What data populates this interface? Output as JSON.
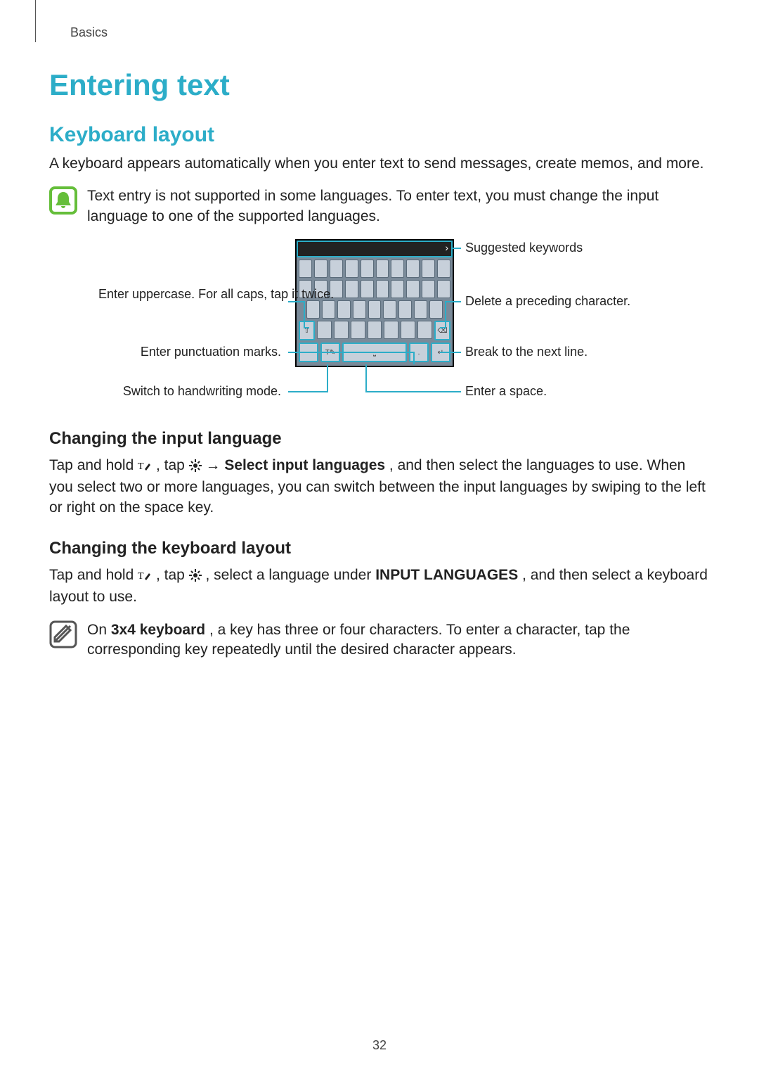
{
  "breadcrumb": "Basics",
  "page_number": "32",
  "title": "Entering text",
  "section1": {
    "heading": "Keyboard layout",
    "intro": "A keyboard appears automatically when you enter text to send messages, create memos, and more.",
    "note": "Text entry is not supported in some languages. To enter text, you must change the input language to one of the supported languages."
  },
  "diagram": {
    "labels": {
      "suggested": "Suggested keywords",
      "delete": "Delete a preceding character.",
      "break": "Break to the next line.",
      "space": "Enter a space.",
      "uppercase": "Enter uppercase. For all caps, tap it twice.",
      "punct": "Enter punctuation marks.",
      "handwriting": "Switch to handwriting mode."
    }
  },
  "section2": {
    "heading": "Changing the input language",
    "p_before": "Tap and hold ",
    "p_mid1": ", tap ",
    "arrow": " → ",
    "bold": "Select input languages",
    "p_after": ", and then select the languages to use. When you select two or more languages, you can switch between the input languages by swiping to the left or right on the space key."
  },
  "section3": {
    "heading": "Changing the keyboard layout",
    "p_before": "Tap and hold ",
    "p_mid1": ", tap ",
    "p_mid2": ", select a language under ",
    "bold": "INPUT LANGUAGES",
    "p_after": ", and then select a keyboard layout to use.",
    "note_before": "On ",
    "note_bold": "3x4 keyboard",
    "note_after": ", a key has three or four characters. To enter a character, tap the corresponding key repeatedly until the desired character appears."
  }
}
